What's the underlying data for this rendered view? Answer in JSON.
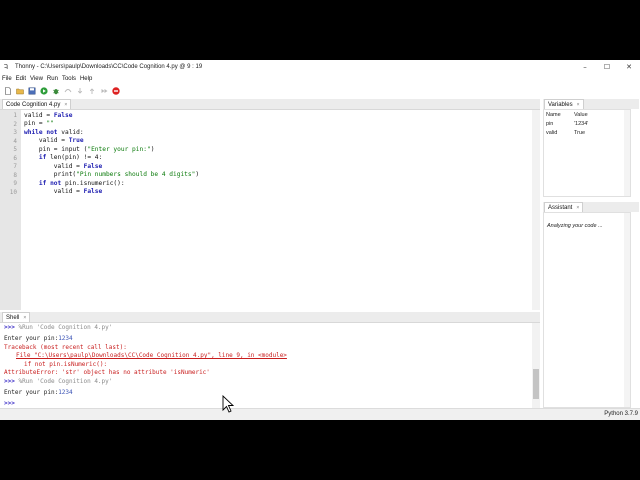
{
  "window": {
    "title": "Thonny  -  C:\\Users\\paulp\\Downloads\\CC\\Code Cognition 4.py  @  9 : 19",
    "minimize": "–",
    "maximize": "☐",
    "close": "✕"
  },
  "menu": [
    "File",
    "Edit",
    "View",
    "Run",
    "Tools",
    "Help"
  ],
  "toolbar": [
    "new-file",
    "open-file",
    "save-file",
    "run",
    "debug",
    "step-over",
    "step-into",
    "step-out",
    "resume",
    "stop"
  ],
  "editor": {
    "tab": "Code Cognition 4.py",
    "tab_close": "×",
    "line_numbers": [
      "1",
      "2",
      "3",
      "4",
      "5",
      "6",
      "7",
      "8",
      "9",
      "10"
    ]
  },
  "variables": {
    "tab": "Variables",
    "tab_close": "×",
    "col_name": "Name",
    "col_value": "Value",
    "rows": [
      {
        "name": "pin",
        "value": "'1234'"
      },
      {
        "name": "valid",
        "value": "True"
      }
    ]
  },
  "assistant": {
    "tab": "Assistant",
    "tab_close": "×",
    "text": "Analyzing your code ..."
  },
  "shell": {
    "tab": "Shell",
    "tab_close": "×",
    "prompt": ">>>",
    "run1": " %Run 'Code Cognition 4.py'",
    "enter_label": "Enter your pin:",
    "pin_value": "1234",
    "tb_header": "Traceback (most recent call last):",
    "tb_file": "File \"C:\\Users\\paulp\\Downloads\\CC\\Code Cognition 4.py\", line 9, in <module>",
    "tb_code": "if not pin.isNumeric():",
    "tb_error": "AttributeError: 'str' object has no attribute 'isNumeric'",
    "run2": " %Run 'Code Cognition 4.py'",
    "enter_label2": "Enter your pin:",
    "pin_value2": "1234"
  },
  "status": {
    "version": "Python 3.7.9"
  }
}
